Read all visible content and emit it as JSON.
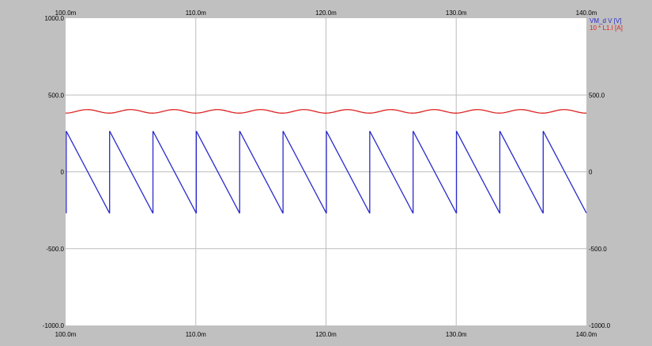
{
  "chart_data": {
    "type": "line",
    "x_unit_suffix": "m",
    "xlim": [
      100.0,
      140.0
    ],
    "ylim": [
      -1000.0,
      1000.0
    ],
    "grid": true,
    "legend_placement": "top-right",
    "x_ticks": [
      "100.0m",
      "110.0m",
      "120.0m",
      "130.0m",
      "140.0m"
    ],
    "x_tick_values": [
      100.0,
      110.0,
      120.0,
      130.0,
      140.0
    ],
    "y_ticks_left": [
      "1000.0",
      "500.0",
      "0",
      "-500.0",
      "-1000.0"
    ],
    "y_ticks_right": [
      "",
      "500.0",
      "0",
      "-500.0",
      "-1000.0"
    ],
    "y_tick_values": [
      1000.0,
      500.0,
      0.0,
      -500.0,
      -1000.0
    ],
    "series": [
      {
        "name": "VM_d V [V]",
        "color": "#2a2acc",
        "shape": "sawtooth",
        "period_ms": 3.33,
        "phase_start_ms": 100.05,
        "peak": 265,
        "trough": -270,
        "x": [
          100.05,
          103.38,
          106.71,
          110.04,
          113.37,
          116.7,
          120.03,
          123.36,
          126.69,
          130.02,
          133.35,
          136.68,
          140.0
        ],
        "values": [
          265,
          265,
          265,
          265,
          265,
          265,
          265,
          265,
          265,
          265,
          265,
          265,
          -270
        ]
      },
      {
        "name": "10 * L1.I [A]",
        "color": "#dd2222",
        "shape": "ripple",
        "period_ms": 3.33,
        "mean": 392,
        "peak": 405,
        "trough": 382,
        "x": [
          100.0,
          101.6,
          103.3,
          104.9,
          106.6,
          108.3,
          109.9,
          111.6,
          113.3,
          114.9,
          116.6,
          118.3,
          119.9,
          121.6,
          123.3,
          124.9,
          126.6,
          128.3,
          129.9,
          131.6,
          133.3,
          134.9,
          136.6,
          138.3,
          140.0
        ],
        "values": [
          382,
          405,
          382,
          405,
          382,
          405,
          382,
          405,
          382,
          405,
          382,
          405,
          382,
          405,
          382,
          405,
          382,
          405,
          382,
          405,
          382,
          405,
          382,
          405,
          382
        ]
      }
    ]
  }
}
